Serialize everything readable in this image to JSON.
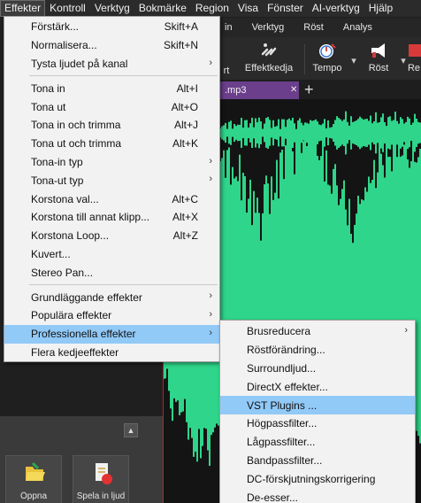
{
  "menubar": {
    "items": [
      "Effekter",
      "Kontroll",
      "Verktyg",
      "Bokmärke",
      "Region",
      "Visa",
      "Fönster",
      "AI-verktyg",
      "Hjälp"
    ]
  },
  "ribbon": {
    "tabs": [
      "in",
      "Verktyg",
      "Röst",
      "Analys"
    ],
    "buttons": {
      "partial_label": "rt",
      "effektkedja": "Effektkedja",
      "tempo": "Tempo",
      "rost": "Röst",
      "partial_end": "Re"
    }
  },
  "file_tab": {
    "name": ".mp3",
    "close": "✕",
    "new": "+"
  },
  "bottom_panel": {
    "collapse": "▲",
    "tiles": [
      "Öppna",
      "Spela in ljud"
    ]
  },
  "colors": {
    "menu_bg": "#f2f2f2",
    "highlight": "#91c9f7",
    "wave": "#2fd58a",
    "menubar": "#2b2b2b",
    "file_tab": "#6b3f8c"
  },
  "main_menu": {
    "groups": [
      [
        {
          "label": "Förstärk...",
          "shortcut": "Skift+A"
        },
        {
          "label": "Normalisera...",
          "shortcut": "Skift+N"
        },
        {
          "label": "Tysta ljudet på kanal",
          "submenu": true
        }
      ],
      [
        {
          "label": "Tona in",
          "shortcut": "Alt+I"
        },
        {
          "label": "Tona ut",
          "shortcut": "Alt+O"
        },
        {
          "label": "Tona in och trimma",
          "shortcut": "Alt+J"
        },
        {
          "label": "Tona ut och trimma",
          "shortcut": "Alt+K"
        },
        {
          "label": "Tona-in typ",
          "submenu": true
        },
        {
          "label": "Tona-ut typ",
          "submenu": true
        },
        {
          "label": "Korstona val...",
          "shortcut": "Alt+C"
        },
        {
          "label": "Korstona till annat klipp...",
          "shortcut": "Alt+X"
        },
        {
          "label": "Korstona Loop...",
          "shortcut": "Alt+Z"
        },
        {
          "label": "Kuvert..."
        },
        {
          "label": "Stereo Pan..."
        }
      ],
      [
        {
          "label": "Grundläggande effekter",
          "submenu": true
        },
        {
          "label": "Populära effekter",
          "submenu": true
        },
        {
          "label": "Professionella effekter",
          "submenu": true,
          "highlighted": true
        },
        {
          "label": "Flera kedjeeffekter"
        }
      ]
    ]
  },
  "sub_menu": {
    "items": [
      {
        "label": "Brusreducera",
        "submenu": true
      },
      {
        "label": "Röstförändring..."
      },
      {
        "label": "Surroundljud..."
      },
      {
        "label": "DirectX effekter..."
      },
      {
        "label": "VST Plugins ...",
        "highlighted": true
      },
      {
        "label": "Högpassfilter..."
      },
      {
        "label": "Lågpassfilter..."
      },
      {
        "label": "Bandpassfilter..."
      },
      {
        "label": "DC-förskjutningskorrigering"
      },
      {
        "label": "De-esser..."
      }
    ]
  }
}
